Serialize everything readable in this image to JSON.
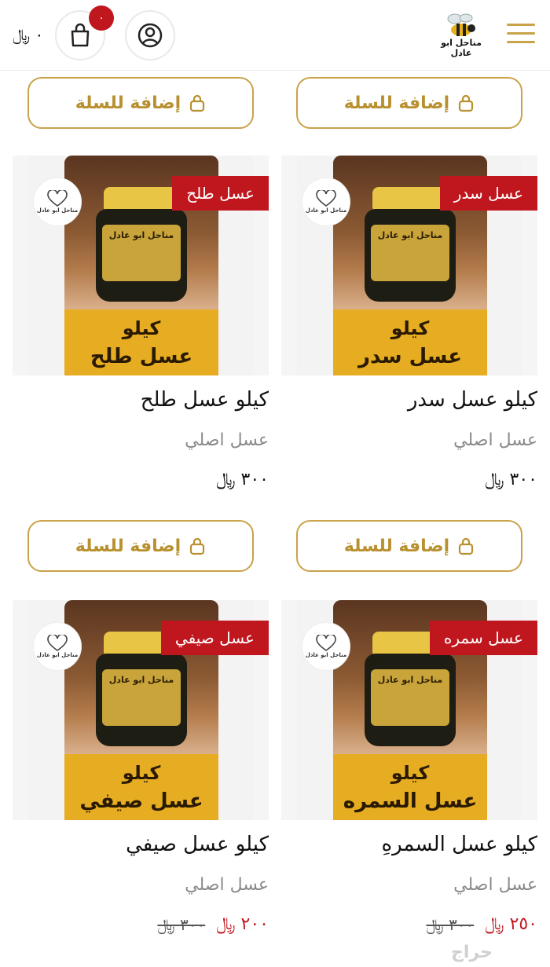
{
  "header": {
    "cart_total": "٠ ﷼",
    "cart_badge": "٠",
    "logo_text": "مناحل ابو عادل",
    "icons": {
      "cart": "shopping-bag-icon",
      "user": "user-icon",
      "menu": "hamburger-menu-icon"
    }
  },
  "add_to_cart_label": "إضافة للسلة",
  "products": [
    {
      "tag": "عسل سدر",
      "name": "كيلو عسل سدر",
      "subtitle": "عسل اصلي",
      "price": "٣٠٠ ﷼",
      "old_price": "",
      "image_kilo": "كيلو",
      "image_name": "عسل سدر",
      "jar_label": "مناحل ابو عادل"
    },
    {
      "tag": "عسل طلح",
      "name": "كيلو عسل طلح",
      "subtitle": "عسل اصلي",
      "price": "٣٠٠ ﷼",
      "old_price": "",
      "image_kilo": "كيلو",
      "image_name": "عسل طلح",
      "jar_label": "مناحل ابو عادل"
    },
    {
      "tag": "عسل سمره",
      "name": "كيلو عسل السمرهِ",
      "subtitle": "عسل اصلي",
      "price": "٢٥٠ ﷼",
      "old_price": "٣٠٠ ﷼",
      "image_kilo": "كيلو",
      "image_name": "عسل السمره",
      "jar_label": "مناحل ابو عادل"
    },
    {
      "tag": "عسل صيفي",
      "name": "كيلو عسل صيفي",
      "subtitle": "عسل اصلي",
      "price": "٢٠٠ ﷼",
      "old_price": "٣٠٠ ﷼",
      "image_kilo": "كيلو",
      "image_name": "عسل صيفي",
      "jar_label": "مناحل ابو عادل"
    }
  ],
  "watermark": "حراج",
  "colors": {
    "gold": "#c9a24a",
    "tag_red": "#c0171f",
    "honey_yellow": "#e6ac22"
  }
}
